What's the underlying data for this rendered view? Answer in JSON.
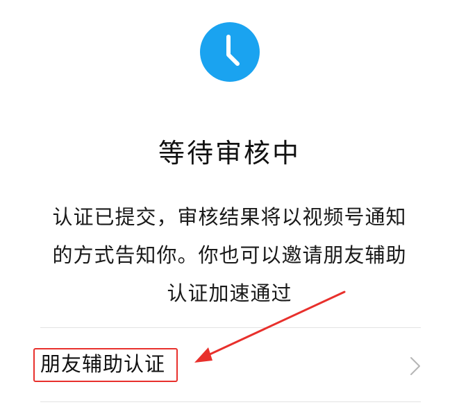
{
  "status": {
    "icon": "clock-icon",
    "icon_color": "#1aa3f0",
    "title": "等待审核中"
  },
  "description": {
    "lines": [
      "认证已提交，审核结果将以视频号通知",
      "的方式告知你。你也可以邀请朋友辅助",
      "认证加速通过"
    ]
  },
  "menu": {
    "friend_assist_label": "朋友辅助认证",
    "chevron_icon": "chevron-right-icon"
  },
  "annotation": {
    "color": "#e8302c",
    "arrow_icon": "red-arrow-annotation",
    "highlight": "red-highlight-box"
  }
}
